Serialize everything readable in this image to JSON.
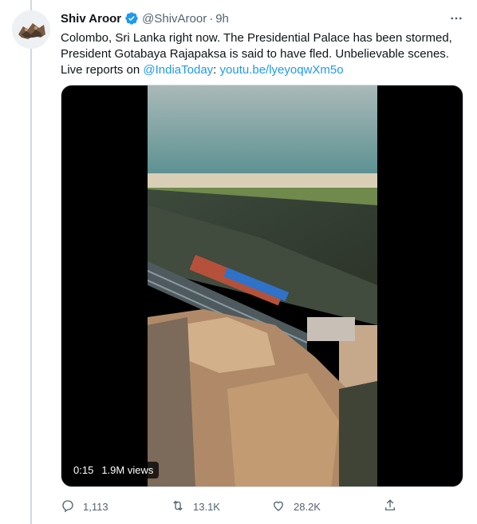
{
  "tweet": {
    "author_name": "Shiv Aroor",
    "handle": "@ShivAroor",
    "separator": "·",
    "time": "9h",
    "text_main": "Colombo, Sri Lanka right now. The Presidential Palace has been stormed, President Gotabaya Rajapaksa is said to have fled. Unbelievable scenes. Live reports on ",
    "mention": "@IndiaToday",
    "colon": ":",
    "link": "youtu.be/lyeyoqwXm5o"
  },
  "video": {
    "duration": "0:15",
    "views": "1.9M views"
  },
  "actions": {
    "replies": "1,113",
    "retweets": "13.1K",
    "likes": "28.2K"
  },
  "icons": [
    "verified-icon",
    "more-icon",
    "reply-icon",
    "retweet-icon",
    "like-icon",
    "share-icon"
  ],
  "colors": {
    "link": "#1d9bf0",
    "verified": "#1d9bf0",
    "secondary_text": "#536471"
  }
}
